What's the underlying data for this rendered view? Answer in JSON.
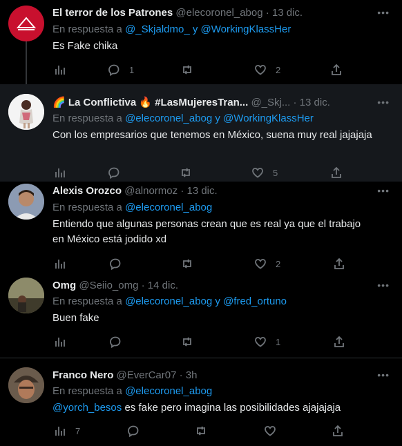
{
  "labels": {
    "in_reply_to": "En respuesta a",
    "and": "y",
    "dot": "·"
  },
  "tweets": [
    {
      "name": "El terror de los Patrones",
      "handle": "@elecoronel_abog",
      "time": "13 dic.",
      "reply_to": [
        "@_Skjaldmo_",
        "@WorkingKlassHer"
      ],
      "text": "Es Fake chika",
      "text_mention": "",
      "counts": {
        "views": "",
        "replies": "1",
        "retweets": "",
        "likes": "2"
      }
    },
    {
      "name": "🌈 La Conflictiva 🔥 #LasMujeresTran...",
      "handle": "@_Skj...",
      "time": "13 dic.",
      "reply_to": [
        "@elecoronel_abog",
        "@WorkingKlassHer"
      ],
      "text": "Con los empresarios que tenemos en México, suena muy real jajajaja",
      "text_mention": "",
      "counts": {
        "views": "",
        "replies": "",
        "retweets": "",
        "likes": "5"
      }
    },
    {
      "name": "Alexis Orozco",
      "handle": "@alnormoz",
      "time": "13 dic.",
      "reply_to": [
        "@elecoronel_abog"
      ],
      "text": "Entiendo que algunas personas crean que es real ya que el trabajo en México está jodido xd",
      "text_mention": "",
      "counts": {
        "views": "",
        "replies": "",
        "retweets": "",
        "likes": "2"
      }
    },
    {
      "name": "Omg",
      "handle": "@Seiio_omg",
      "time": "14 dic.",
      "reply_to": [
        "@elecoronel_abog",
        "@fred_ortuno"
      ],
      "text": "Buen fake",
      "text_mention": "",
      "counts": {
        "views": "",
        "replies": "",
        "retweets": "",
        "likes": "1"
      }
    },
    {
      "name": "Franco Nero",
      "handle": "@EverCar07",
      "time": "3h",
      "reply_to": [
        "@elecoronel_abog"
      ],
      "text": " es fake pero imagina las posibilidades ajajajaja",
      "text_mention": "@yorch_besos",
      "counts": {
        "views": "7",
        "replies": "",
        "retweets": "",
        "likes": ""
      }
    }
  ],
  "colors": {
    "background": "#000000",
    "highlight": "#15181c",
    "link": "#1d9bf0",
    "muted": "#71767b",
    "text": "#e7e9ea"
  },
  "icons": [
    "more-icon",
    "views-icon",
    "reply-icon",
    "retweet-icon",
    "like-icon",
    "share-icon"
  ]
}
